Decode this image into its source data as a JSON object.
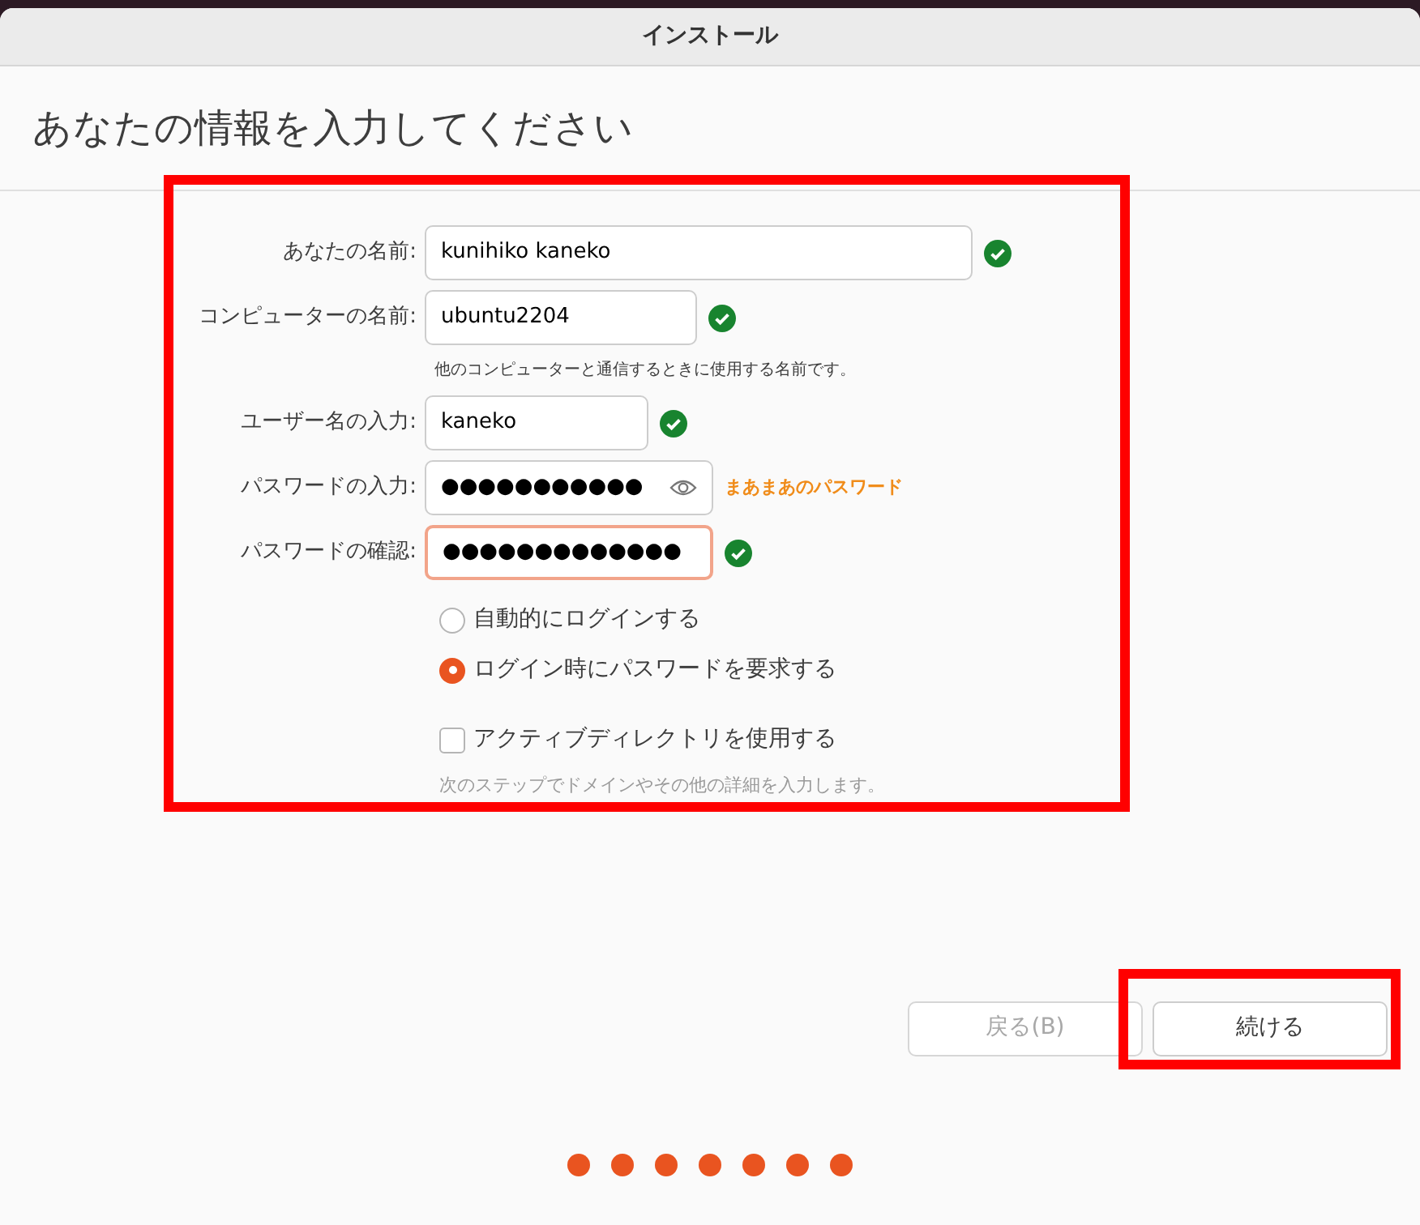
{
  "window": {
    "title": "インストール"
  },
  "heading": "あなたの情報を入力してください",
  "fields": [
    {
      "label": "あなたの名前:",
      "value": "kunihiko kaneko",
      "kind": "text",
      "valid": true,
      "focused": false
    },
    {
      "label": "コンピューターの名前:",
      "value": "ubuntu2204",
      "kind": "text",
      "valid": true,
      "focused": false,
      "hint": "他のコンピューターと通信するときに使用する名前です。"
    },
    {
      "label": "ユーザー名の入力:",
      "value": "kaneko",
      "kind": "text",
      "valid": true,
      "focused": false
    },
    {
      "label": "パスワードの入力:",
      "value": "●●●●●●●●●●●",
      "kind": "password",
      "valid": false,
      "focused": false,
      "strength": "まあまあのパスワード"
    },
    {
      "label": "パスワードの確認:",
      "value": "●●●●●●●●●●●●●",
      "kind": "text",
      "valid": true,
      "focused": true
    }
  ],
  "login_options": [
    {
      "label": "自動的にログインする",
      "selected": false
    },
    {
      "label": "ログイン時にパスワードを要求する",
      "selected": true
    }
  ],
  "active_directory": {
    "label": "アクティブディレクトリを使用する",
    "checked": false,
    "hint": "次のステップでドメインやその他の詳細を入力します。"
  },
  "buttons": [
    {
      "label": "戻る(B)",
      "disabled": true
    },
    {
      "label": "続ける",
      "disabled": false
    }
  ],
  "steps": [
    {
      "done": true
    },
    {
      "done": true
    },
    {
      "done": true
    },
    {
      "done": true
    },
    {
      "done": true
    },
    {
      "done": true
    },
    {
      "done": true
    }
  ]
}
